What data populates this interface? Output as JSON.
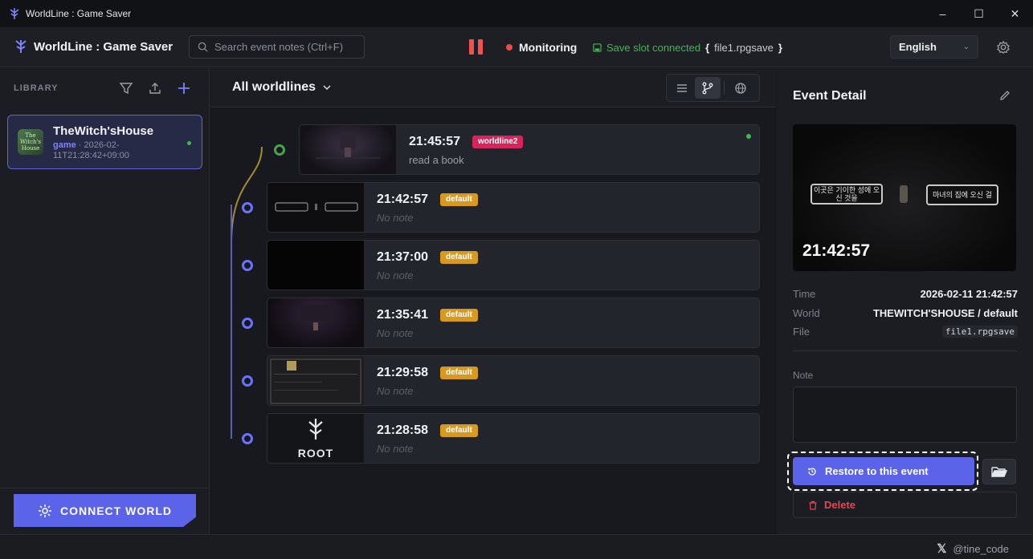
{
  "window": {
    "title": "WorldLine : Game Saver",
    "controls": [
      "–",
      "☐",
      "✕"
    ]
  },
  "header": {
    "brand": "WorldLine : Game Saver",
    "search_placeholder": "Search event notes (Ctrl+F)",
    "monitor_label": "Monitoring",
    "slot_status": "Save slot connected",
    "slot_brace_open": "{",
    "slot_file": "file1.rpgsave",
    "slot_brace_close": "}",
    "language": "English",
    "colors": {
      "accent": "#5b63e8",
      "danger": "#f0524f",
      "success": "#3fb950"
    }
  },
  "sidebar": {
    "title": "LIBRARY",
    "games": [
      {
        "name": "TheWitch'sHouse",
        "tag": "game",
        "meta": " · 2026-02-11T21:28:42+09:00",
        "thumb_text": "The Witch's House"
      }
    ],
    "connect_label": "CONNECT WORLD"
  },
  "center": {
    "worldline_select": "All worldlines",
    "events": [
      {
        "time": "21:45:57",
        "badge": "worldline2",
        "note": "read a book",
        "thumb": "dark-room"
      },
      {
        "time": "21:42:57",
        "badge": "default",
        "note": "No note",
        "thumb": "dialog-strip"
      },
      {
        "time": "21:37:00",
        "badge": "default",
        "note": "No note",
        "thumb": "black"
      },
      {
        "time": "21:35:41",
        "badge": "default",
        "note": "No note",
        "thumb": "dark-room"
      },
      {
        "time": "21:29:58",
        "badge": "default",
        "note": "No note",
        "thumb": "inventory"
      },
      {
        "time": "21:28:58",
        "badge": "default",
        "note": "No note",
        "thumb": "root"
      }
    ],
    "root_label": "ROOT"
  },
  "detail": {
    "title": "Event Detail",
    "preview_time": "21:42:57",
    "dialog_left": "이곳은 기이한 성에 오신 것을",
    "dialog_right": "마녀의 집에 오신 걸",
    "time_label": "Time",
    "time_value": "2026-02-11 21:42:57",
    "world_label": "World",
    "world_value": "THEWITCH'SHOUSE / default",
    "file_label": "File",
    "file_value": "file1.rpgsave",
    "note_label": "Note",
    "note_value": "",
    "restore_label": "Restore to this event",
    "delete_label": "Delete"
  },
  "footer": {
    "x_label": "𝕏",
    "handle": "@tine_code"
  }
}
